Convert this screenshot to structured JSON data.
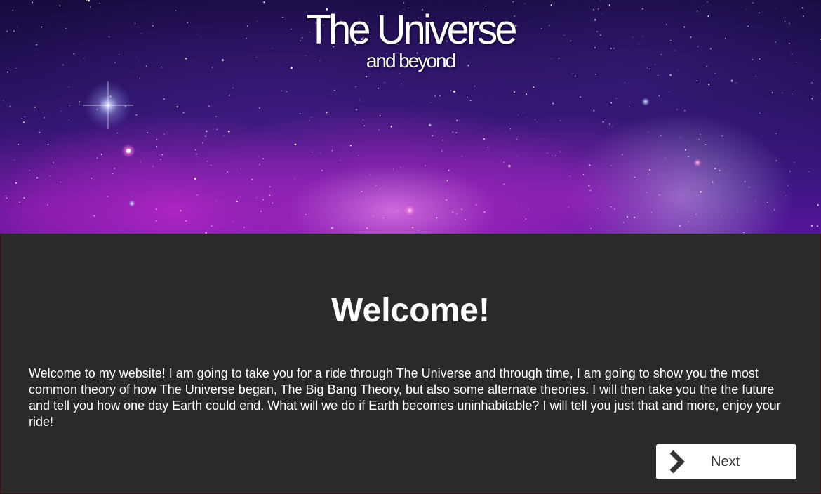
{
  "header": {
    "title": "The Universe",
    "subtitle": "and beyond"
  },
  "main": {
    "heading": "Welcome!",
    "intro": "Welcome to my website! I am going to take you for a ride through The Universe and through time, I am going to show you the most common theory of how The Universe began, The Big Bang Theory, but also some alternate theories. I will then take you the the future and tell you how one day Earth could end. What will we do if Earth becomes uninhabitable? I will tell you just that and more, enjoy your ride!",
    "next_button": {
      "label": "Next",
      "icon": "chevron-right-icon"
    }
  },
  "colors": {
    "content_background": "#2a2a2a",
    "button_background": "#ffffff",
    "button_text": "#333333",
    "text": "#ffffff"
  }
}
